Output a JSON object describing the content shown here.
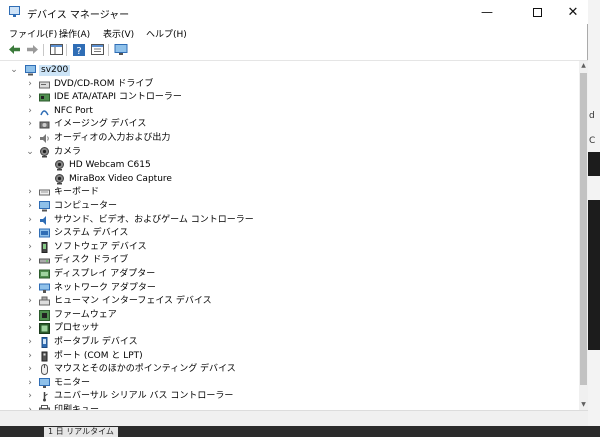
{
  "window": {
    "title": "デバイス マネージャー",
    "minimize_glyph": "—",
    "close_glyph": "✕"
  },
  "menu": [
    "ファイル(F)",
    "操作(A)",
    "表示(V)",
    "ヘルプ(H)"
  ],
  "tree": {
    "root": "sv200",
    "items": [
      {
        "label": "DVD/CD-ROM ドライブ",
        "icon": "optical-drive-icon",
        "expanded": false
      },
      {
        "label": "IDE ATA/ATAPI コントローラー",
        "icon": "ide-controller-icon",
        "expanded": false
      },
      {
        "label": "NFC Port",
        "icon": "nfc-icon",
        "expanded": false
      },
      {
        "label": "イメージング デバイス",
        "icon": "imaging-device-icon",
        "expanded": false
      },
      {
        "label": "オーディオの入力および出力",
        "icon": "speaker-icon",
        "expanded": false
      },
      {
        "label": "カメラ",
        "icon": "camera-icon",
        "expanded": true,
        "children": [
          "HD Webcam C615",
          "MiraBox Video Capture"
        ]
      },
      {
        "label": "キーボード",
        "icon": "keyboard-icon",
        "expanded": false
      },
      {
        "label": "コンピューター",
        "icon": "computer-icon",
        "expanded": false
      },
      {
        "label": "サウンド、ビデオ、およびゲーム コントローラー",
        "icon": "sound-icon",
        "expanded": false
      },
      {
        "label": "システム デバイス",
        "icon": "system-device-icon",
        "expanded": false
      },
      {
        "label": "ソフトウェア デバイス",
        "icon": "software-device-icon",
        "expanded": false
      },
      {
        "label": "ディスク ドライブ",
        "icon": "disk-drive-icon",
        "expanded": false
      },
      {
        "label": "ディスプレイ アダプター",
        "icon": "display-adapter-icon",
        "expanded": false
      },
      {
        "label": "ネットワーク アダプター",
        "icon": "network-adapter-icon",
        "expanded": false
      },
      {
        "label": "ヒューマン インターフェイス デバイス",
        "icon": "hid-icon",
        "expanded": false
      },
      {
        "label": "ファームウェア",
        "icon": "firmware-icon",
        "expanded": false
      },
      {
        "label": "プロセッサ",
        "icon": "processor-icon",
        "expanded": false
      },
      {
        "label": "ポータブル デバイス",
        "icon": "portable-device-icon",
        "expanded": false
      },
      {
        "label": "ポート (COM と LPT)",
        "icon": "port-icon",
        "expanded": false
      },
      {
        "label": "マウスとそのほかのポインティング デバイス",
        "icon": "mouse-icon",
        "expanded": false
      },
      {
        "label": "モニター",
        "icon": "monitor-icon",
        "expanded": false
      },
      {
        "label": "ユニバーサル シリアル バス コントローラー",
        "icon": "usb-icon",
        "expanded": false
      },
      {
        "label": "印刷キュー",
        "icon": "printer-icon",
        "expanded": false
      }
    ]
  },
  "background": {
    "edge_text_1": "d",
    "edge_text_2": "C",
    "taskbar_label": "1 日 リアルタイム"
  },
  "colors": {
    "selection": "#cce4f7",
    "accent_blue": "#2f6db5"
  }
}
